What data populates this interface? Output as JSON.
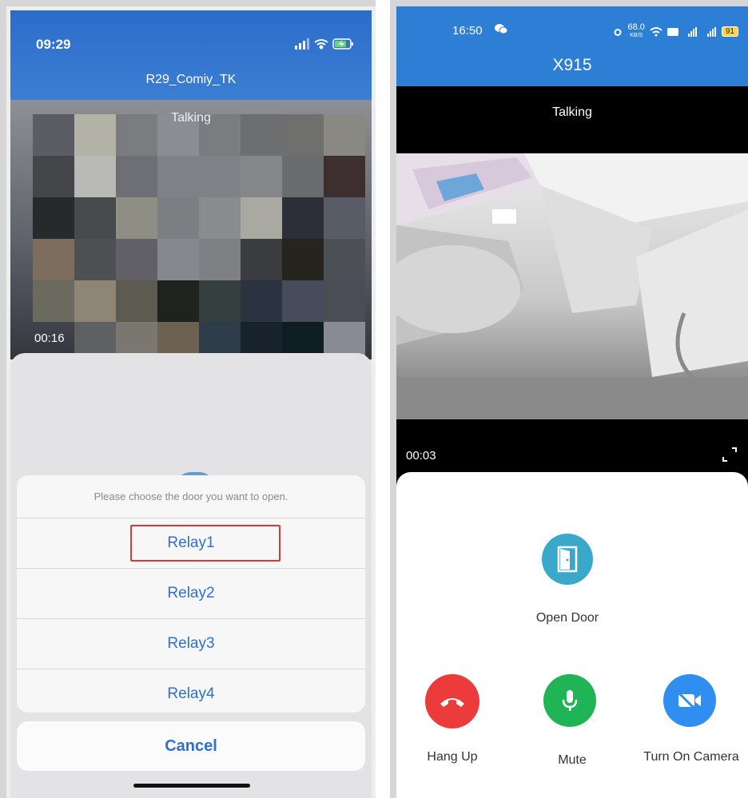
{
  "left_screen": {
    "status_time": "09:29",
    "title": "R29_Comiy_TK",
    "call_status": "Talking",
    "timer": "00:16",
    "action_sheet": {
      "message": "Please choose the door you want to open.",
      "items": [
        "Relay1",
        "Relay2",
        "Relay3",
        "Relay4"
      ],
      "highlighted": "Relay1",
      "cancel_label": "Cancel"
    },
    "colors": {
      "header": "#2b6cc9",
      "accent": "#2f6fd1",
      "highlight": "#d83a37"
    }
  },
  "right_screen": {
    "status_time": "16:50",
    "status_speed": "68.0",
    "status_speed_unit": "KB/S",
    "status_battery": "91",
    "title": "X915",
    "call_status": "Talking",
    "timer": "00:03",
    "actions": {
      "open_door": "Open Door",
      "hang_up": "Hang Up",
      "mute": "Mute",
      "camera": "Turn On Camera"
    },
    "icons": [
      "wechat-icon",
      "expand-icon",
      "door-icon",
      "phone-hangup-icon",
      "microphone-icon",
      "camera-off-icon"
    ],
    "colors": {
      "header": "#2d7fd6",
      "open_door": "#3aa9c9",
      "hang_up": "#ec3b3b",
      "mute": "#1fb455",
      "camera": "#2f8ef0"
    }
  }
}
